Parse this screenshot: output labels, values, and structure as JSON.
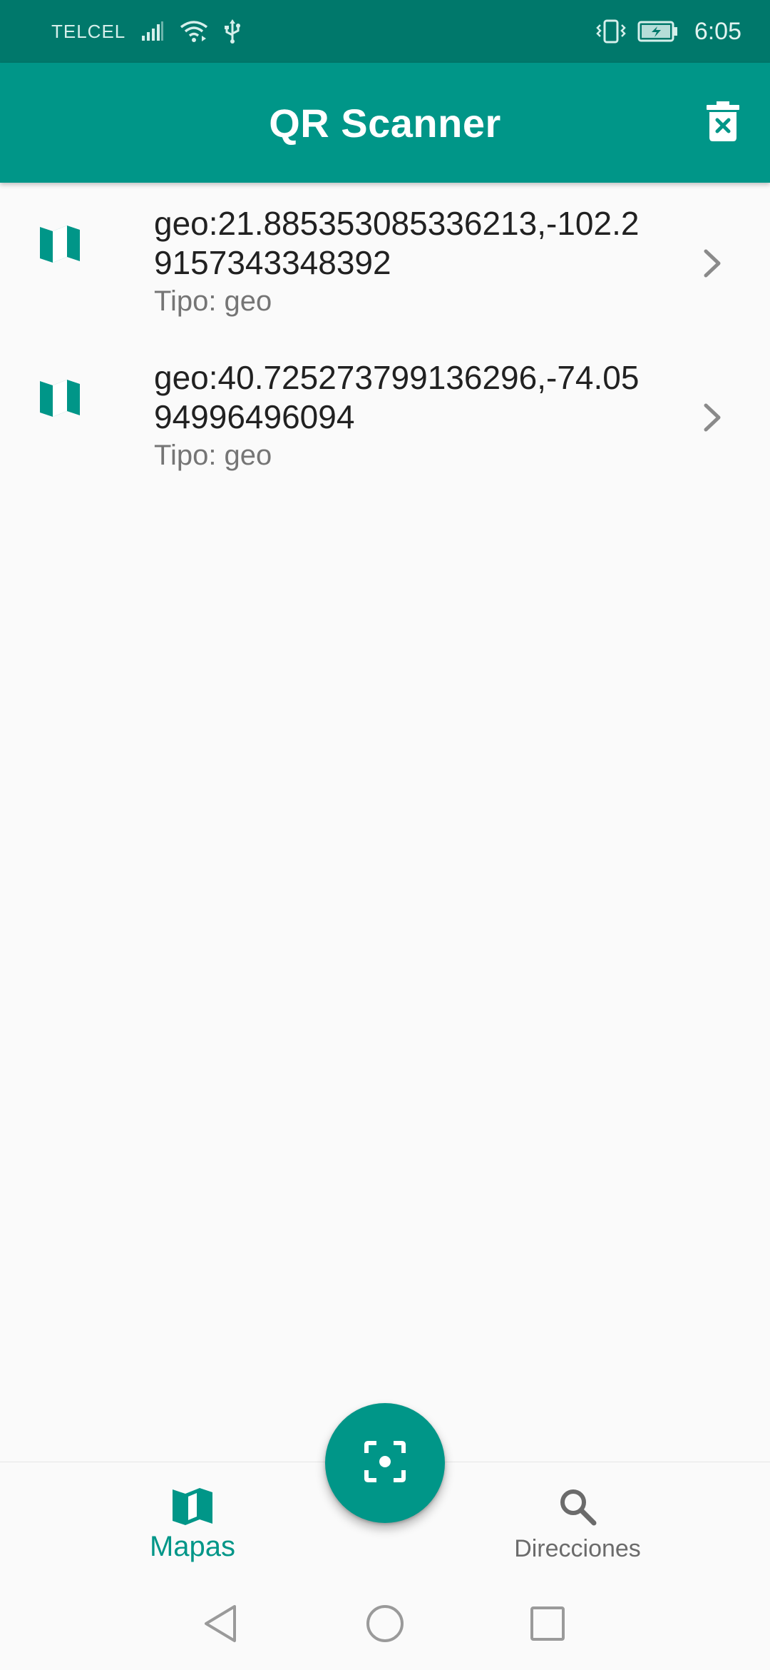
{
  "status_bar": {
    "carrier": "TELCEL",
    "time": "6:05",
    "icons": [
      "signal-icon",
      "wifi-icon",
      "usb-icon",
      "vibrate-icon",
      "battery-charging-icon"
    ]
  },
  "app_bar": {
    "title": "QR Scanner",
    "action_icon": "delete-icon"
  },
  "list": {
    "items": [
      {
        "title": "geo:21.885353085336213,-102.29157343348392",
        "subtitle": "Tipo: geo",
        "icon": "map-icon"
      },
      {
        "title": "geo:40.725273799136296,-74.0594996496094",
        "subtitle": "Tipo: geo",
        "icon": "map-icon"
      }
    ]
  },
  "fab": {
    "icon": "scan-icon"
  },
  "bottom_nav": {
    "items": [
      {
        "label": "Mapas",
        "icon": "map-icon",
        "active": true
      },
      {
        "label": "Direcciones",
        "icon": "search-icon",
        "active": false
      }
    ]
  },
  "system_nav": [
    "back-icon",
    "home-icon",
    "recents-icon"
  ],
  "colors": {
    "primary": "#009688",
    "primary_dark": "#00786b",
    "background": "#fafafa",
    "text_primary": "#212121",
    "text_secondary": "#757575"
  }
}
